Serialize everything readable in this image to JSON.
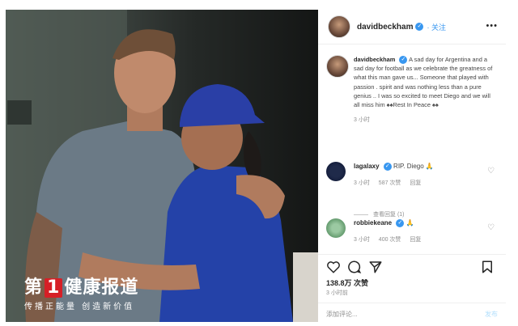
{
  "brand": {
    "title_pre": "第",
    "title_num": "1",
    "title_post": "健康报道",
    "subtitle": "传播正能量 创造新价值"
  },
  "header": {
    "username": "davidbeckham",
    "follow_label": "· 关注",
    "more_icon": "more-horizontal-icon"
  },
  "caption": {
    "username": "davidbeckham",
    "text": "A sad day for Argentina and a sad day for football as we celebrate the greatness of what this man gave us... Someone that played with passion . spirit and was nothing less than a pure genius .. I was so excited to meet Diego and we will all miss him ♠♠Rest In Peace ♠♠",
    "time": "3 小时"
  },
  "comments": [
    {
      "username": "lagalaxy",
      "text": "RIP. Diego 🙏",
      "time": "3 小时",
      "likes": "587 次赞",
      "reply": "回复",
      "replies_label": "查看回复 (1)"
    },
    {
      "username": "robbiekeane",
      "text": "🙏",
      "time": "3 小时",
      "likes": "400 次赞",
      "reply": "回复"
    }
  ],
  "post": {
    "likes": "138.8万 次赞",
    "time": "3 小时前",
    "add_comment_placeholder": "添加评论...",
    "post_label": "发布"
  },
  "colors": {
    "accent": "#3897f0",
    "brand_red": "#d61f26"
  }
}
